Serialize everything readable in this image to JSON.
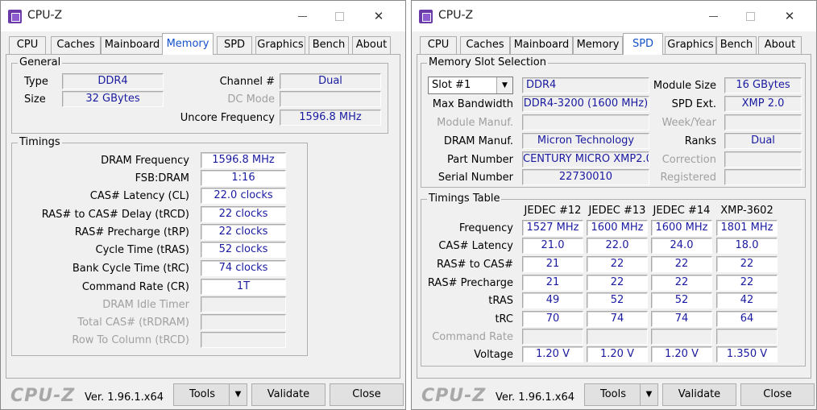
{
  "app_title": "CPU-Z",
  "window_controls": {
    "minimize": "—",
    "maximize": "☐",
    "close": "✕"
  },
  "tabs": [
    "CPU",
    "Caches",
    "Mainboard",
    "Memory",
    "SPD",
    "Graphics",
    "Bench",
    "About"
  ],
  "footer": {
    "logo": "CPU-Z",
    "version": "Ver. 1.96.1.x64",
    "tools": "Tools",
    "tools_arrow": "▼",
    "validate": "Validate",
    "close": "Close"
  },
  "memory": {
    "general_title": "General",
    "type_label": "Type",
    "type": "DDR4",
    "size_label": "Size",
    "size": "32 GBytes",
    "channel_label": "Channel #",
    "channel": "Dual",
    "dcmode_label": "DC Mode",
    "dcmode": "",
    "uncore_label": "Uncore Frequency",
    "uncore": "1596.8 MHz",
    "timings_title": "Timings",
    "timings": [
      {
        "label": "DRAM Frequency",
        "value": "1596.8 MHz",
        "enabled": true
      },
      {
        "label": "FSB:DRAM",
        "value": "1:16",
        "enabled": true
      },
      {
        "label": "CAS# Latency (CL)",
        "value": "22.0 clocks",
        "enabled": true
      },
      {
        "label": "RAS# to CAS# Delay (tRCD)",
        "value": "22 clocks",
        "enabled": true
      },
      {
        "label": "RAS# Precharge (tRP)",
        "value": "22 clocks",
        "enabled": true
      },
      {
        "label": "Cycle Time (tRAS)",
        "value": "52 clocks",
        "enabled": true
      },
      {
        "label": "Bank Cycle Time (tRC)",
        "value": "74 clocks",
        "enabled": true
      },
      {
        "label": "Command Rate (CR)",
        "value": "1T",
        "enabled": true
      },
      {
        "label": "DRAM Idle Timer",
        "value": "",
        "enabled": false
      },
      {
        "label": "Total CAS# (tRDRAM)",
        "value": "",
        "enabled": false
      },
      {
        "label": "Row To Column (tRCD)",
        "value": "",
        "enabled": false
      }
    ]
  },
  "spd": {
    "slot_title": "Memory Slot Selection",
    "slot_selected": "Slot #1",
    "slot_arrow": "▼",
    "type": "DDR4",
    "module_size_label": "Module Size",
    "module_size": "16 GBytes",
    "max_bw_label": "Max Bandwidth",
    "max_bw": "DDR4-3200 (1600 MHz)",
    "spd_ext_label": "SPD Ext.",
    "spd_ext": "XMP 2.0",
    "module_manuf_label": "Module Manuf.",
    "module_manuf": "",
    "week_year_label": "Week/Year",
    "week_year": "",
    "dram_manuf_label": "DRAM Manuf.",
    "dram_manuf": "Micron Technology",
    "ranks_label": "Ranks",
    "ranks": "Dual",
    "part_label": "Part Number",
    "part": "CENTURY MICRO XMP2.0",
    "correction_label": "Correction",
    "correction": "",
    "serial_label": "Serial Number",
    "serial": "22730010",
    "registered_label": "Registered",
    "registered": "",
    "timings_title": "Timings Table",
    "columns": [
      "JEDEC #12",
      "JEDEC #13",
      "JEDEC #14",
      "XMP-3602"
    ],
    "rows": [
      {
        "label": "Frequency",
        "values": [
          "1527 MHz",
          "1600 MHz",
          "1600 MHz",
          "1801 MHz"
        ],
        "enabled": true
      },
      {
        "label": "CAS# Latency",
        "values": [
          "21.0",
          "22.0",
          "24.0",
          "18.0"
        ],
        "enabled": true
      },
      {
        "label": "RAS# to CAS#",
        "values": [
          "21",
          "22",
          "22",
          "22"
        ],
        "enabled": true
      },
      {
        "label": "RAS# Precharge",
        "values": [
          "21",
          "22",
          "22",
          "22"
        ],
        "enabled": true
      },
      {
        "label": "tRAS",
        "values": [
          "49",
          "52",
          "52",
          "42"
        ],
        "enabled": true
      },
      {
        "label": "tRC",
        "values": [
          "70",
          "74",
          "74",
          "64"
        ],
        "enabled": true
      },
      {
        "label": "Command Rate",
        "values": [
          "",
          "",
          "",
          ""
        ],
        "enabled": false
      },
      {
        "label": "Voltage",
        "values": [
          "1.20 V",
          "1.20 V",
          "1.20 V",
          "1.350 V"
        ],
        "enabled": true
      }
    ]
  }
}
